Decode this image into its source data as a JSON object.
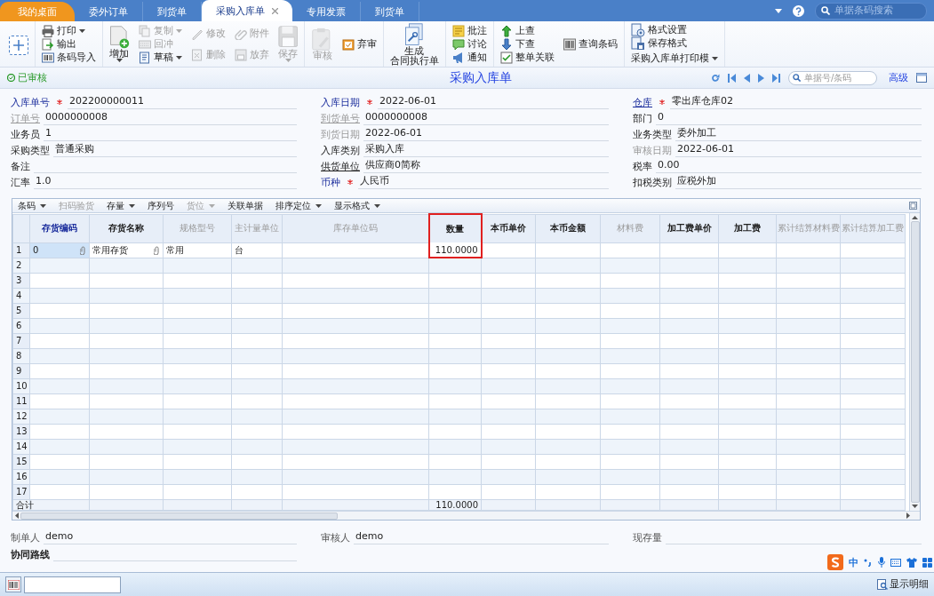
{
  "tab_bar": {
    "tabs": [
      {
        "label": "我的桌面",
        "kind": "home",
        "selected": false,
        "closable": false
      },
      {
        "label": "委外订单",
        "kind": "doc",
        "selected": false,
        "closable": false
      },
      {
        "label": "到货单",
        "kind": "doc",
        "selected": false,
        "closable": false
      },
      {
        "label": "采购入库单",
        "kind": "doc",
        "selected": true,
        "closable": true
      },
      {
        "label": "专用发票",
        "kind": "doc",
        "selected": false,
        "closable": false
      },
      {
        "label": "到货单",
        "kind": "doc",
        "selected": false,
        "closable": false
      }
    ],
    "search_placeholder": "单据条码搜索"
  },
  "ribbon": {
    "groups": [
      {
        "columns": [
          [
            {
              "kind": "new",
              "disabled": false,
              "dropdown": false
            }
          ]
        ]
      },
      {
        "columns": [
          [
            {
              "label": "打印",
              "kind": "small",
              "disabled": false,
              "dropdown": true
            },
            {
              "label": "输出",
              "kind": "small",
              "disabled": false,
              "dropdown": false
            },
            {
              "label": "条码导入",
              "kind": "small",
              "disabled": false,
              "dropdown": false
            }
          ]
        ]
      },
      {
        "columns": [
          [
            {
              "label": "增加",
              "kind": "large",
              "disabled": false,
              "dropdown": true
            }
          ],
          [
            {
              "label": "复制",
              "kind": "small",
              "disabled": true,
              "dropdown": true
            },
            {
              "label": "回冲",
              "kind": "small",
              "disabled": true,
              "dropdown": false
            },
            {
              "label": "草稿",
              "kind": "small",
              "disabled": false,
              "dropdown": true
            }
          ],
          [
            {
              "label": "修改",
              "kind": "small",
              "disabled": true,
              "dropdown": false
            },
            {
              "label": "删除",
              "kind": "small",
              "disabled": true,
              "dropdown": false
            }
          ],
          [
            {
              "label": "附件",
              "kind": "small",
              "disabled": true,
              "dropdown": false
            },
            {
              "label": "放弃",
              "kind": "small",
              "disabled": true,
              "dropdown": false
            }
          ],
          [
            {
              "label": "保存",
              "kind": "large",
              "disabled": true,
              "dropdown": true
            }
          ]
        ]
      },
      {
        "columns": [
          [
            {
              "label": "审核",
              "kind": "large",
              "disabled": true,
              "dropdown": false
            }
          ],
          [
            {
              "label": "弃审",
              "kind": "small",
              "disabled": false,
              "dropdown": false
            }
          ]
        ]
      },
      {
        "columns": [
          [
            {
              "lines": [
                "生成",
                "合同执行单"
              ],
              "kind": "large",
              "disabled": false,
              "dropdown": false
            }
          ]
        ]
      },
      {
        "columns": [
          [
            {
              "label": "批注",
              "kind": "small",
              "disabled": false,
              "dropdown": false
            },
            {
              "label": "讨论",
              "kind": "small",
              "disabled": false,
              "dropdown": false
            },
            {
              "label": "通知",
              "kind": "small",
              "disabled": false,
              "dropdown": false
            }
          ]
        ]
      },
      {
        "columns": [
          [
            {
              "label": "上查",
              "kind": "small",
              "disabled": false,
              "dropdown": false
            },
            {
              "label": "下查",
              "kind": "small",
              "disabled": false,
              "dropdown": false
            },
            {
              "label": "整单关联",
              "kind": "small",
              "disabled": false,
              "dropdown": false
            }
          ],
          [
            {
              "label": "查询条码",
              "kind": "small",
              "disabled": false,
              "dropdown": false
            }
          ]
        ]
      },
      {
        "columns": [
          [
            {
              "label": "格式设置",
              "kind": "small",
              "disabled": false,
              "dropdown": false
            },
            {
              "label": "保存格式",
              "kind": "small",
              "disabled": false,
              "dropdown": false
            },
            {
              "label": "采购入库单打印模",
              "kind": "menu",
              "disabled": false,
              "dropdown": true
            }
          ]
        ]
      }
    ]
  },
  "title_bar": {
    "status": "已审核",
    "title": "采购入库单",
    "search_placeholder": "单据号/条码",
    "advanced_link": "高级"
  },
  "form": {
    "columns": [
      [
        {
          "label": "入库单号",
          "kind": "key",
          "required": true,
          "value": "202200000011"
        },
        {
          "label": "订单号",
          "kind": "muted_ref",
          "required": false,
          "value": "0000000008"
        },
        {
          "label": "业务员",
          "kind": "plain",
          "required": false,
          "value": "1"
        },
        {
          "label": "采购类型",
          "kind": "plain",
          "required": false,
          "value": "普通采购"
        },
        {
          "label": "备注",
          "kind": "plain",
          "required": false
        },
        {
          "label": "汇率",
          "kind": "plain",
          "required": false,
          "value": "1.0"
        }
      ],
      [
        {
          "label": "入库日期",
          "kind": "key",
          "required": true,
          "value": "2022-06-01"
        },
        {
          "label": "到货单号",
          "kind": "muted_ref",
          "required": false,
          "value": "0000000008"
        },
        {
          "label": "到货日期",
          "kind": "muted",
          "required": false,
          "value": "2022-06-01"
        },
        {
          "label": "入库类别",
          "kind": "plain",
          "required": false,
          "value": "采购入库"
        },
        {
          "label": "供货单位",
          "kind": "ref",
          "required": false,
          "value": "供应商0简称"
        },
        {
          "label": "币种",
          "kind": "key",
          "required": true,
          "value": "人民币"
        }
      ],
      [
        {
          "label": "仓库",
          "kind": "key_ref",
          "required": true,
          "value": "零出库仓库02"
        },
        {
          "label": "部门",
          "kind": "plain",
          "required": false,
          "value": "0"
        },
        {
          "label": "业务类型",
          "kind": "plain",
          "required": false,
          "value": "委外加工"
        },
        {
          "label": "审核日期",
          "kind": "muted",
          "required": false,
          "value": "2022-06-01"
        },
        {
          "label": "税率",
          "kind": "plain",
          "required": false,
          "value": "0.00"
        },
        {
          "label": "扣税类别",
          "kind": "plain",
          "required": false,
          "value": "应税外加"
        }
      ]
    ]
  },
  "grid": {
    "toolbar": [
      {
        "label": "条码",
        "dropdown": true,
        "disabled": false
      },
      {
        "label": "扫码验货",
        "dropdown": false,
        "disabled": true
      },
      {
        "label": "存量",
        "dropdown": true,
        "disabled": false
      },
      {
        "label": "序列号",
        "dropdown": false,
        "disabled": false
      },
      {
        "label": "货位",
        "dropdown": true,
        "disabled": true
      },
      {
        "label": "关联单据",
        "dropdown": false,
        "disabled": false
      },
      {
        "label": "排序定位",
        "dropdown": true,
        "disabled": false
      },
      {
        "label": "显示格式",
        "dropdown": true,
        "disabled": false
      }
    ],
    "columns": [
      {
        "label": "存货编码",
        "kind": "key",
        "highlighted": false
      },
      {
        "label": "存货名称",
        "kind": "plain",
        "highlighted": false
      },
      {
        "label": "规格型号",
        "kind": "muted",
        "highlighted": false
      },
      {
        "label": "主计量单位",
        "kind": "muted",
        "highlighted": false
      },
      {
        "label": "库存单位码",
        "kind": "muted",
        "highlighted": false
      },
      {
        "label": "数量",
        "kind": "plain",
        "highlighted": true
      },
      {
        "label": "本币单价",
        "kind": "plain",
        "highlighted": false
      },
      {
        "label": "本币金额",
        "kind": "plain",
        "highlighted": false
      },
      {
        "label": "材料费",
        "kind": "muted",
        "highlighted": false
      },
      {
        "label": "加工费单价",
        "kind": "plain",
        "highlighted": false
      },
      {
        "label": "加工费",
        "kind": "plain",
        "highlighted": false
      },
      {
        "label": "累计结算材料费",
        "kind": "muted",
        "highlighted": false
      },
      {
        "label": "累计结算加工费",
        "kind": "muted",
        "highlighted": false
      }
    ],
    "rows": [
      {
        "number": "1",
        "cells": [
          {
            "text": "0",
            "attachment": true,
            "focused": true,
            "highlighted": false
          },
          {
            "text": "常用存货",
            "attachment": true,
            "focused": false,
            "highlighted": false
          },
          {
            "text": "常用",
            "attachment": false,
            "focused": false,
            "highlighted": false
          },
          {
            "text": "台",
            "attachment": false,
            "focused": false,
            "highlighted": false
          },
          null,
          {
            "text": "110.0000",
            "attachment": false,
            "focused": false,
            "highlighted": true
          }
        ]
      },
      {
        "number": "2"
      },
      {
        "number": "3"
      },
      {
        "number": "4"
      },
      {
        "number": "5"
      },
      {
        "number": "6"
      },
      {
        "number": "7"
      },
      {
        "number": "8"
      },
      {
        "number": "9"
      },
      {
        "number": "10"
      },
      {
        "number": "11"
      },
      {
        "number": "12"
      },
      {
        "number": "13"
      },
      {
        "number": "14"
      },
      {
        "number": "15"
      },
      {
        "number": "16"
      },
      {
        "number": "17"
      }
    ],
    "total": {
      "label": "合计",
      "cells": [
        null,
        null,
        null,
        null,
        null,
        "110.0000"
      ]
    }
  },
  "footer": {
    "rows": [
      [
        {
          "label": "制单人",
          "kind": "plain",
          "value": "demo"
        },
        {
          "label": "审核人",
          "kind": "plain",
          "value": "demo"
        },
        {
          "label": "现存量",
          "kind": "plain"
        }
      ],
      [
        {
          "label": "协同路线",
          "kind": "bold"
        }
      ]
    ]
  },
  "status_bar": {
    "detail_button": "显示明细"
  },
  "ime_bar": {
    "mode": "中"
  }
}
